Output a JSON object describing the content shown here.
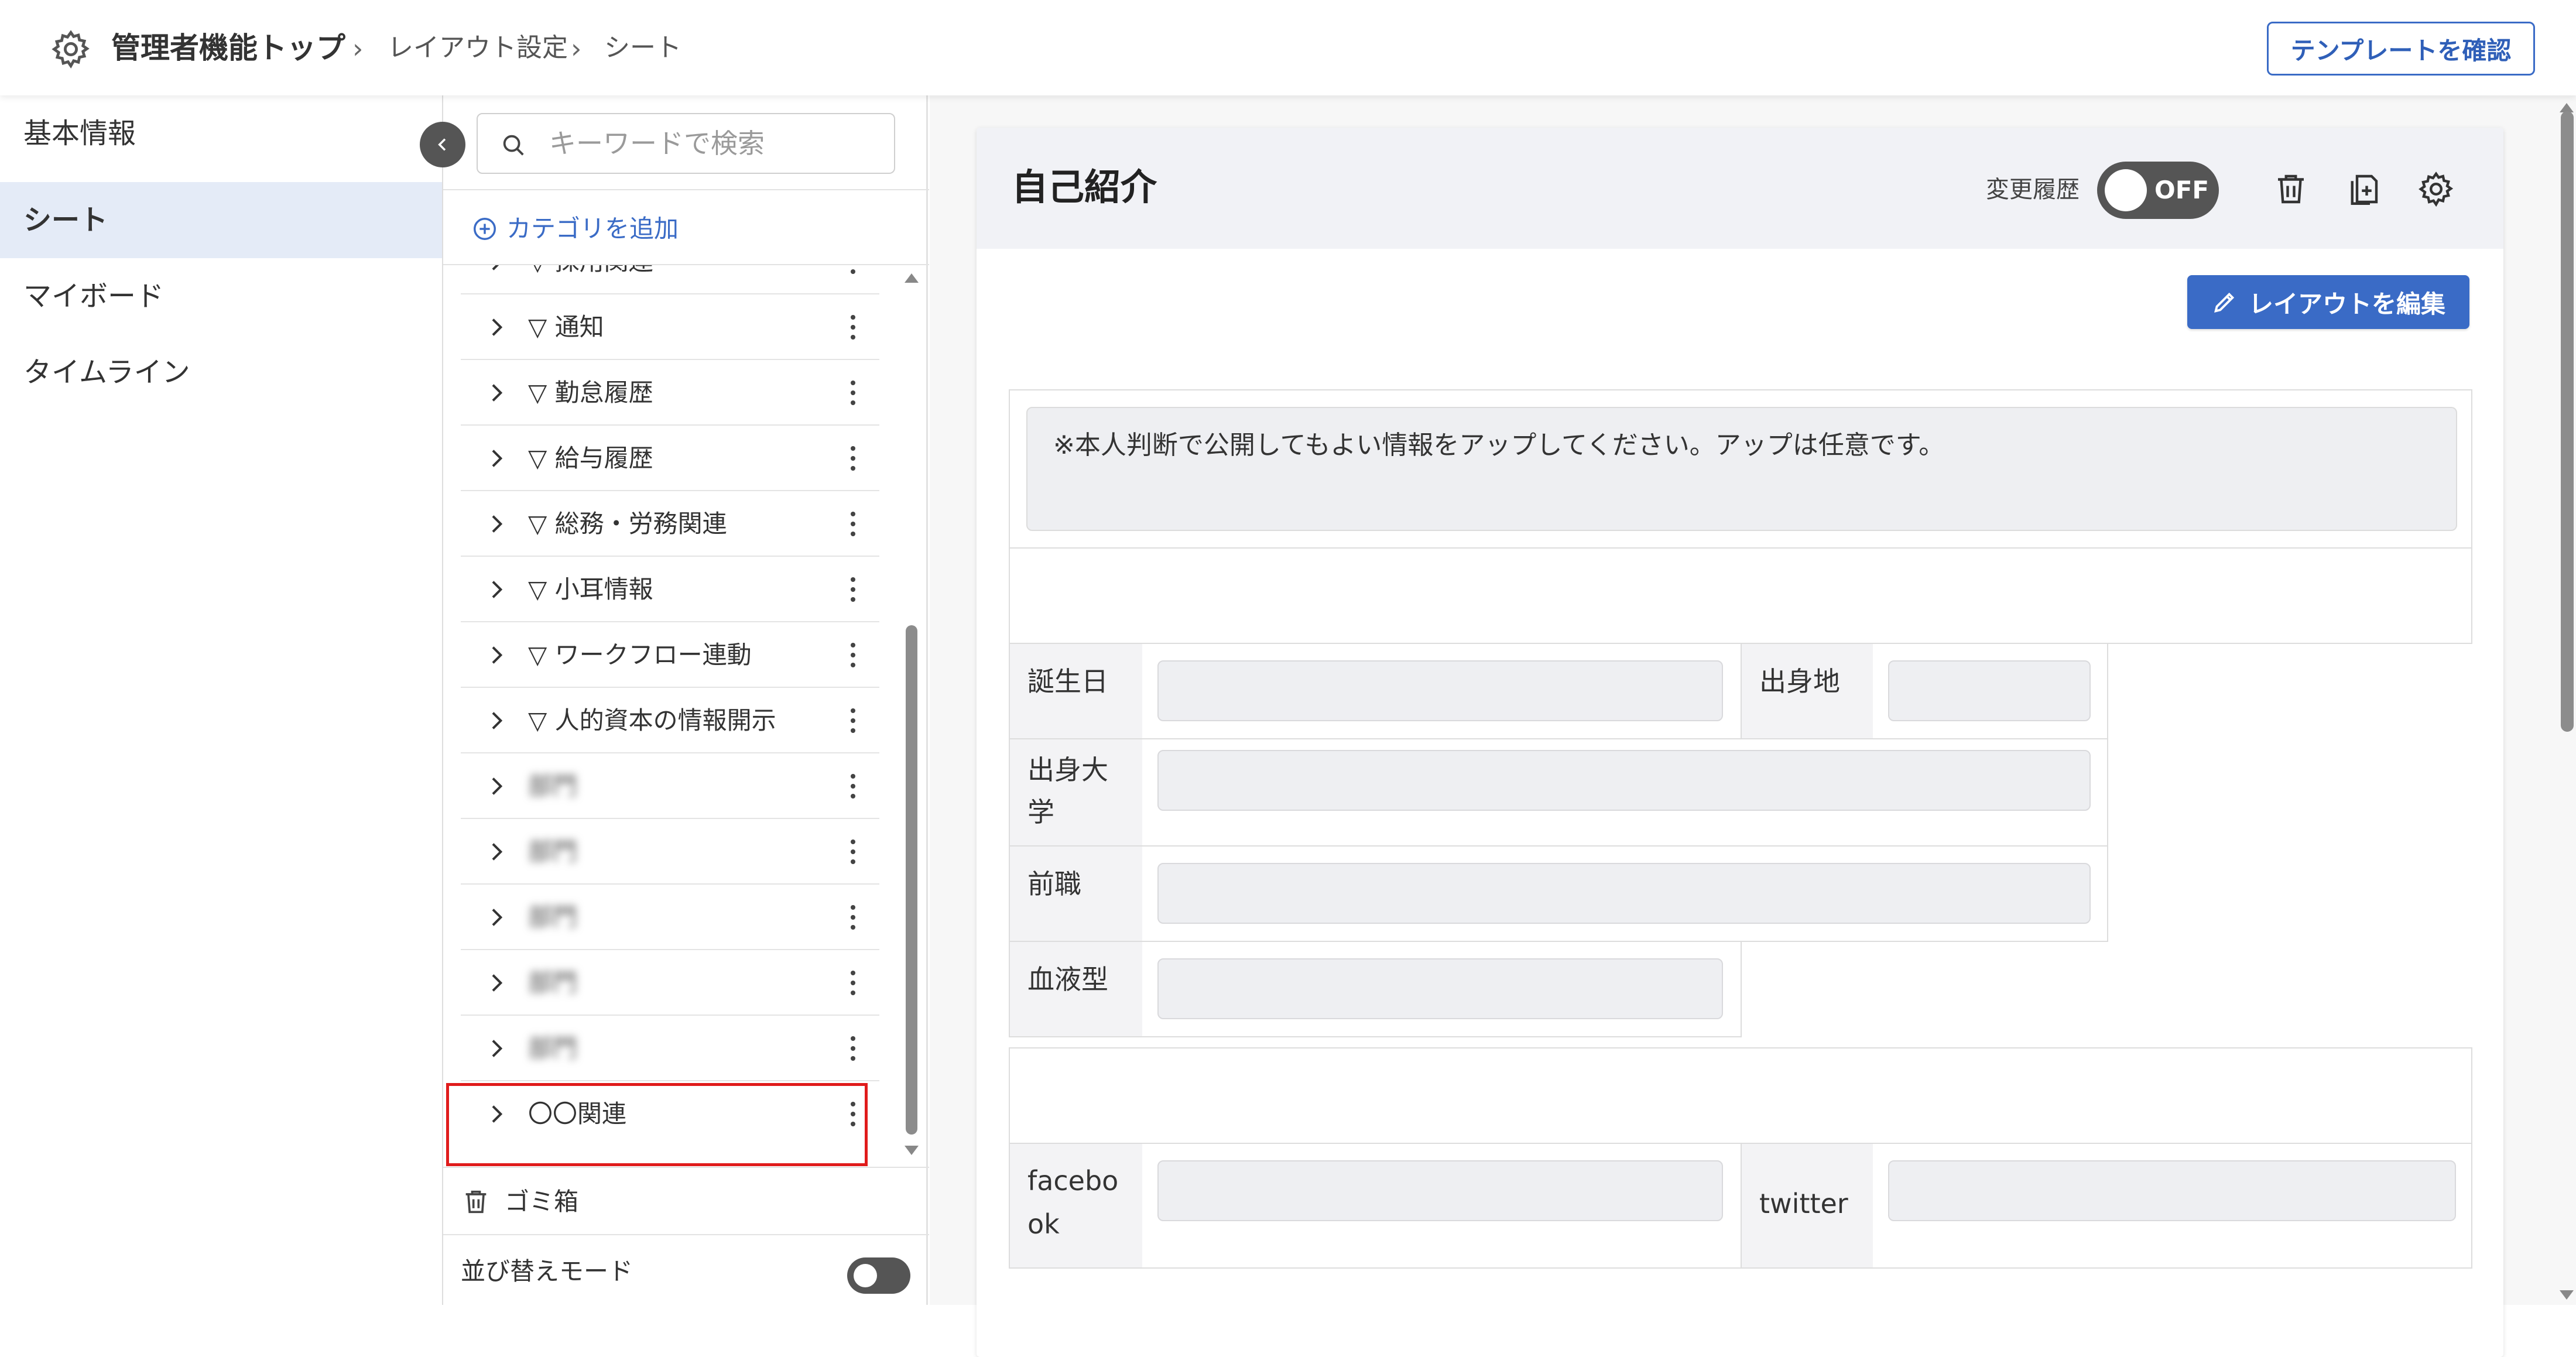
{
  "header": {
    "breadcrumb": {
      "root": "管理者機能トップ",
      "level1": "レイアウト設定",
      "level2": "シート"
    },
    "template_button": "テンプレートを確認"
  },
  "leftnav": {
    "items": [
      {
        "label": "基本情報"
      },
      {
        "label": "シート"
      },
      {
        "label": "マイボード"
      },
      {
        "label": "タイムライン"
      }
    ]
  },
  "category_panel": {
    "search_placeholder": "キーワードで検索",
    "add_category": "カテゴリを追加",
    "partial_item": "▽ 採用関連",
    "items": [
      {
        "label": "▽ 通知"
      },
      {
        "label": "▽ 勤怠履歴"
      },
      {
        "label": "▽ 給与履歴"
      },
      {
        "label": "▽ 総務・労務関連"
      },
      {
        "label": "▽ 小耳情報"
      },
      {
        "label": "▽ ワークフロー連動"
      },
      {
        "label": "▽ 人的資本の情報開示"
      },
      {
        "label": "部門"
      },
      {
        "label": "部門"
      },
      {
        "label": "部門"
      },
      {
        "label": "部門"
      },
      {
        "label": "部門"
      },
      {
        "label": "〇〇関連"
      }
    ],
    "trash_label": "ゴミ箱",
    "sort_mode_label": "並び替えモード"
  },
  "main": {
    "title": "自己紹介",
    "history_label": "変更履歴",
    "history_toggle": "OFF",
    "edit_layout_button": "レイアウトを編集",
    "notice": "※本人判断で公開してもよい情報をアップしてください。アップは任意です。",
    "fields": {
      "birthday": "誕生日",
      "hometown": "出身地",
      "university": "出身大学",
      "previous_job": "前職",
      "blood_type": "血液型",
      "facebook": "facebook",
      "twitter": "twitter"
    }
  },
  "colors": {
    "accent": "#3a6bc6",
    "highlight_box": "#e01b1b",
    "active_nav_bg": "#e4ebf7"
  }
}
